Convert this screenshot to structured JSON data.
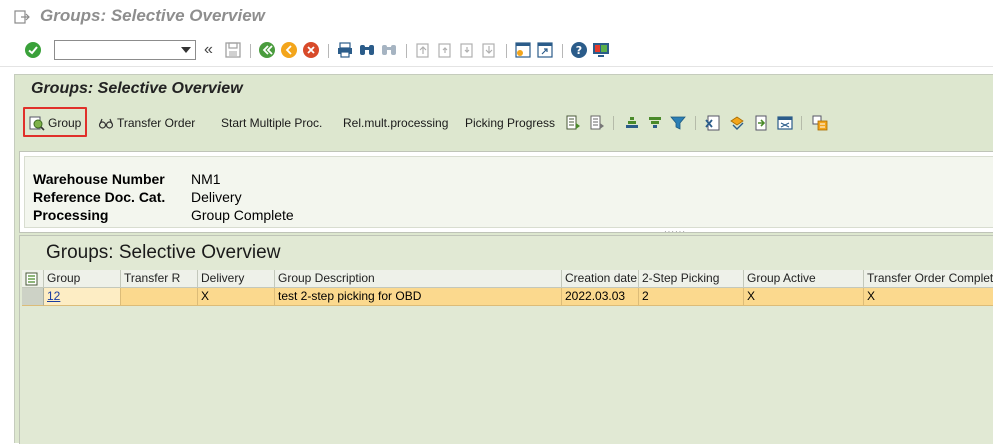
{
  "window": {
    "title": "Groups: Selective Overview"
  },
  "command_field": {
    "value": "",
    "placeholder": ""
  },
  "screen": {
    "title": "Groups: Selective Overview"
  },
  "app_toolbar": {
    "group_label": "Group",
    "transfer_order_label": "Transfer Order",
    "start_multiple_label": "Start Multiple Proc.",
    "rel_mult_label": "Rel.mult.processing",
    "picking_progress_label": "Picking Progress"
  },
  "header_info": [
    {
      "label": "Warehouse Number",
      "value": "NM1"
    },
    {
      "label": "Reference Doc. Cat.",
      "value": "Delivery"
    },
    {
      "label": "Processing",
      "value": "Group Complete"
    }
  ],
  "grid": {
    "title": "Groups: Selective Overview",
    "columns": [
      "Group",
      "Transfer R",
      "Delivery",
      "Group Description",
      "Creation date",
      "2-Step Picking",
      "Group Active",
      "Transfer Order Complet"
    ],
    "rows": [
      [
        "12",
        "",
        "X",
        "test 2-step picking for OBD",
        "2022.03.03",
        "2",
        "X",
        "X"
      ]
    ]
  },
  "colors": {
    "screen_bg": "#dde7cf",
    "row_highlight": "#fbd98e",
    "focus_border": "#e0302a"
  }
}
